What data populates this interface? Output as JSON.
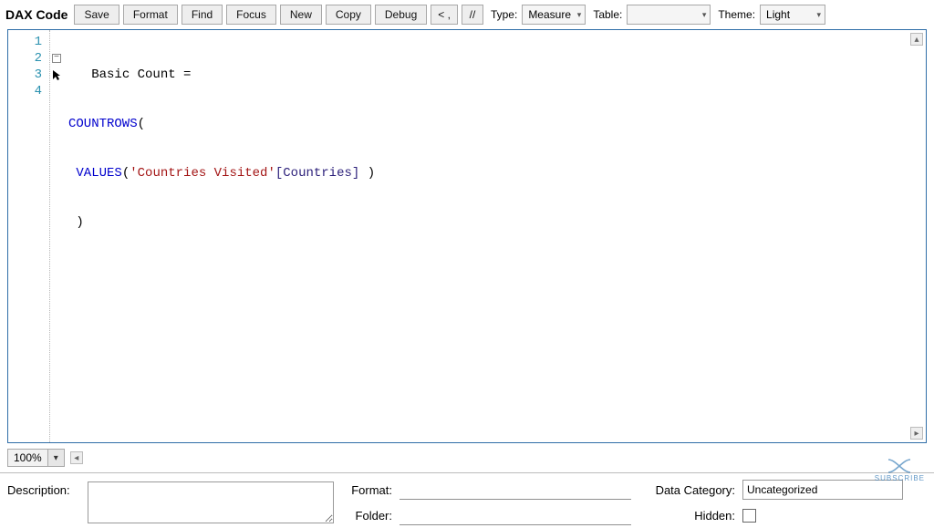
{
  "toolbar": {
    "title": "DAX Code",
    "buttons": {
      "save": "Save",
      "format": "Format",
      "find": "Find",
      "focus": "Focus",
      "new": "New",
      "copy": "Copy",
      "debug": "Debug",
      "lt": "< ,",
      "comment": "//"
    },
    "type_label": "Type:",
    "type_value": "Measure",
    "table_label": "Table:",
    "table_value": "",
    "theme_label": "Theme:",
    "theme_value": "Light"
  },
  "code": {
    "line_numbers": [
      "1",
      "2",
      "3",
      "4"
    ],
    "l1_pre": "   ",
    "l1_name": "Basic Count",
    "l1_eq": " =",
    "l2_fn": "COUNTROWS",
    "l2_open": "(",
    "l3_fn": "VALUES",
    "l3_open": "(",
    "l3_str": "'Countries Visited'",
    "l3_col": "[Countries]",
    "l3_close": " )",
    "l4_close": ")"
  },
  "zoom": {
    "value": "100%"
  },
  "bottom": {
    "description_label": "Description:",
    "description_value": "",
    "format_label": "Format:",
    "format_value": "",
    "folder_label": "Folder:",
    "folder_value": "",
    "datacat_label": "Data Category:",
    "datacat_value": "Uncategorized",
    "hidden_label": "Hidden:"
  },
  "watermark": {
    "text": "SUBSCRIBE"
  }
}
